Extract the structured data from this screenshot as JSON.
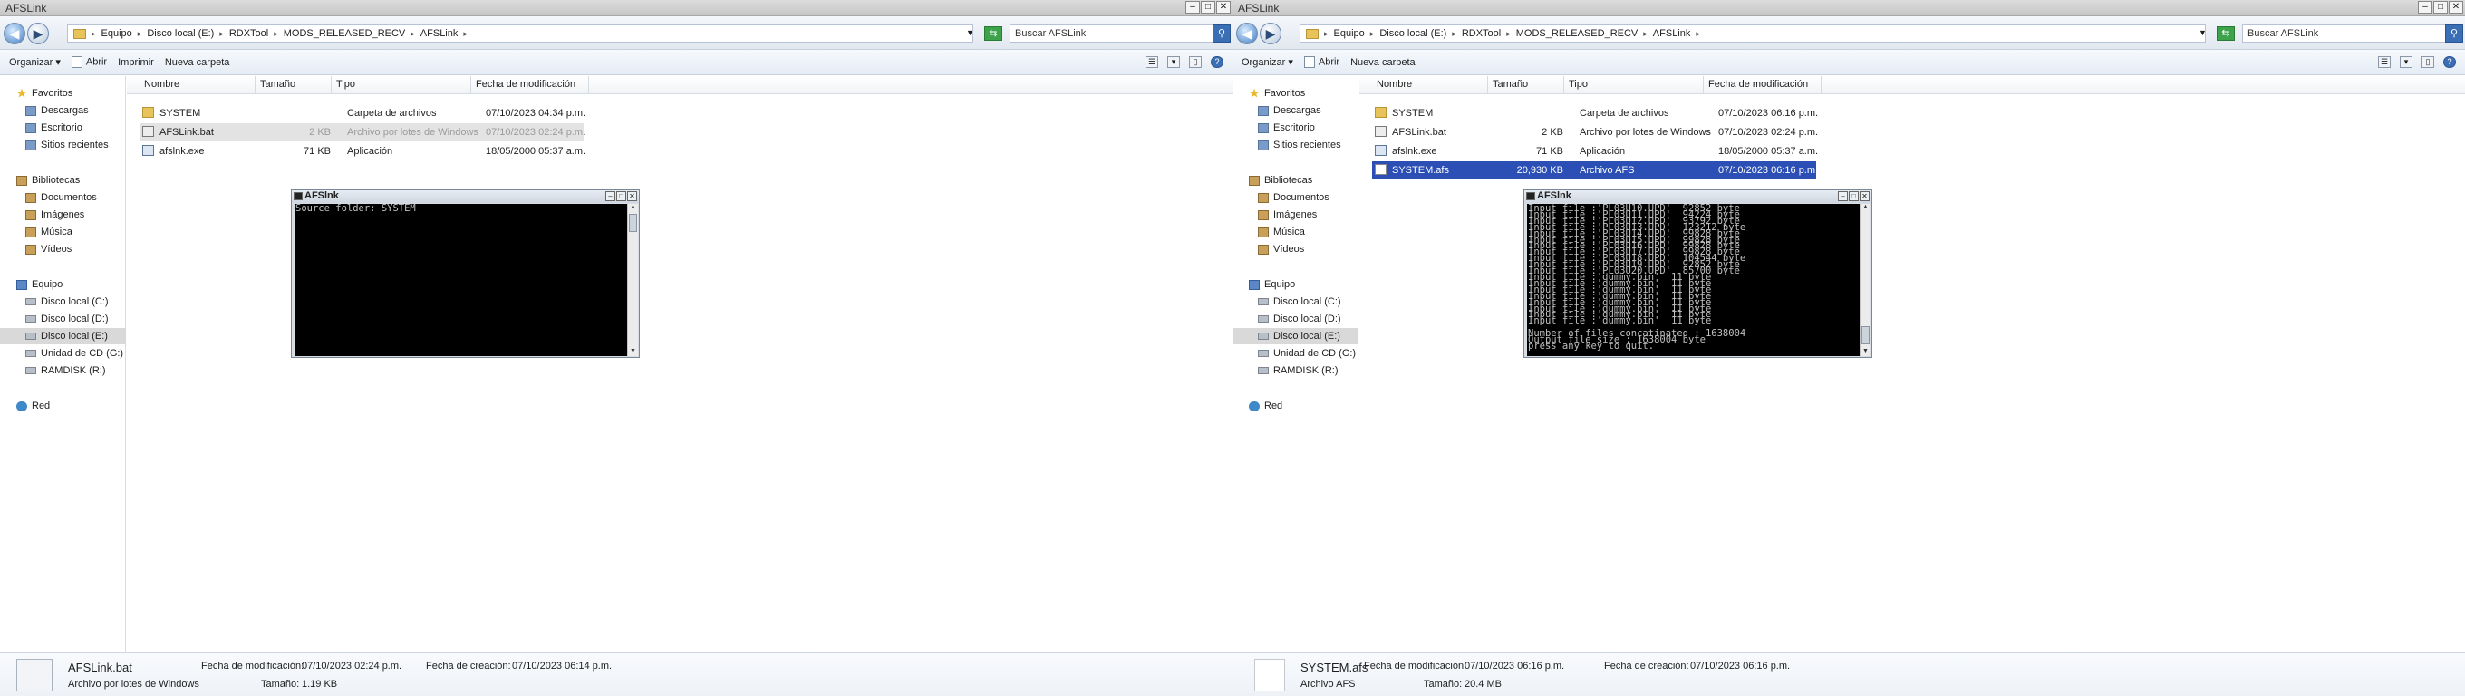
{
  "left": {
    "title": "AFSLink",
    "address": {
      "crumbs": [
        "Equipo",
        "Disco local (E:)",
        "RDXTool",
        "MODS_RELEASED_RECV",
        "AFSLink"
      ],
      "search_placeholder": "Buscar AFSLink"
    },
    "toolbar": {
      "organize": "Organizar",
      "open": "Abrir",
      "print": "Imprimir",
      "new_folder": "Nueva carpeta"
    },
    "columns": {
      "name": "Nombre",
      "size": "Tamaño",
      "type": "Tipo",
      "date": "Fecha de modificación"
    },
    "nav": {
      "favorites": "Favoritos",
      "downloads": "Descargas",
      "desktop": "Escritorio",
      "recent": "Sitios recientes",
      "libraries": "Bibliotecas",
      "documents": "Documentos",
      "images": "Imágenes",
      "music": "Música",
      "videos": "Vídeos",
      "computer": "Equipo",
      "disk_c": "Disco local (C:)",
      "disk_d": "Disco local (D:)",
      "disk_e": "Disco local (E:)",
      "cd_g": "Unidad de CD (G:)",
      "ramdisk": "RAMDISK (R:)",
      "network": "Red"
    },
    "files": [
      {
        "name": "SYSTEM",
        "size": "",
        "type": "Carpeta de archivos",
        "date": "07/10/2023 04:34 p.m."
      },
      {
        "name": "AFSLink.bat",
        "size": "2 KB",
        "type": "Archivo por lotes de Windows",
        "date": "07/10/2023 02:24 p.m."
      },
      {
        "name": "afslnk.exe",
        "size": "71 KB",
        "type": "Aplicación",
        "date": "18/05/2000 05:37 a.m."
      }
    ],
    "details": {
      "name": "AFSLink.bat",
      "type": "Archivo por lotes de Windows",
      "mod_label": "Fecha de modificación:",
      "mod_value": "07/10/2023 02:24 p.m.",
      "size_label": "Tamaño:",
      "size_value": "1.19 KB",
      "created_label": "Fecha de creación:",
      "created_value": "07/10/2023 06:14 p.m."
    },
    "console": {
      "title": "AFSlnk",
      "text": "Source folder: SYSTEM"
    }
  },
  "right": {
    "title": "AFSLink",
    "address": {
      "crumbs": [
        "Equipo",
        "Disco local (E:)",
        "RDXTool",
        "MODS_RELEASED_RECV",
        "AFSLink"
      ],
      "search_placeholder": "Buscar AFSLink"
    },
    "toolbar": {
      "organize": "Organizar",
      "open": "Abrir",
      "new_folder": "Nueva carpeta"
    },
    "columns": {
      "name": "Nombre",
      "size": "Tamaño",
      "type": "Tipo",
      "date": "Fecha de modificación"
    },
    "nav": {
      "favorites": "Favoritos",
      "downloads": "Descargas",
      "desktop": "Escritorio",
      "recent": "Sitios recientes",
      "libraries": "Bibliotecas",
      "documents": "Documentos",
      "images": "Imágenes",
      "music": "Música",
      "videos": "Vídeos",
      "computer": "Equipo",
      "disk_c": "Disco local (C:)",
      "disk_d": "Disco local (D:)",
      "disk_e": "Disco local (E:)",
      "cd_g": "Unidad de CD (G:)",
      "ramdisk": "RAMDISK (R:)",
      "network": "Red"
    },
    "files": [
      {
        "name": "SYSTEM",
        "size": "",
        "type": "Carpeta de archivos",
        "date": "07/10/2023 06:16 p.m."
      },
      {
        "name": "AFSLink.bat",
        "size": "2 KB",
        "type": "Archivo por lotes de Windows",
        "date": "07/10/2023 02:24 p.m."
      },
      {
        "name": "afslnk.exe",
        "size": "71 KB",
        "type": "Aplicación",
        "date": "18/05/2000 05:37 a.m."
      },
      {
        "name": "SYSTEM.afs",
        "size": "20,930 KB",
        "type": "Archivo AFS",
        "date": "07/10/2023 06:16 p.m."
      }
    ],
    "details": {
      "name": "SYSTEM.afs",
      "type": "Archivo AFS",
      "mod_label": "Fecha de modificación:",
      "mod_value": "07/10/2023 06:16 p.m.",
      "size_label": "Tamaño:",
      "size_value": "20.4 MB",
      "created_label": "Fecha de creación:",
      "created_value": "07/10/2023 06:16 p.m."
    },
    "console": {
      "title": "AFSlnk",
      "text": "Input file :'PL03U10.UPD'  92852 byte\nInput file :'PL03U11.UPD'  94224 byte\nInput file :'PL03U12.UPD'  93792 byte\nInput file :'PL03U13.UPD'  123212 byte\nInput file :'PL03U14.UPD'  99828 byte\nInput file :'PL03U15.UPD'  99828 byte\nInput file :'PL03U16.UPD'  99828 byte\nInput file :'PL03U17.UPD'  99828 byte\nInput file :'PL03U18.UPD'  104544 byte\nInput file :'PL03U19.UPD'  92852 byte\nInput file :'PL03U20.UPD'  85700 byte\nInput file :'dummy.bin'  11 byte\nInput file :'dummy.bin'  11 byte\nInput file :'dummy.bin'  11 byte\nInput file :'dummy.bin'  11 byte\nInput file :'dummy.bin'  11 byte\nInput file :'dummy.bin'  11 byte\nInput file :'dummy.bin'  11 byte\nInput file :'dummy.bin'  11 byte\n\nNumber of files concatinated : 1638004\nOutput file size : 1638004 byte\npress any key to quit.\n_"
    }
  }
}
